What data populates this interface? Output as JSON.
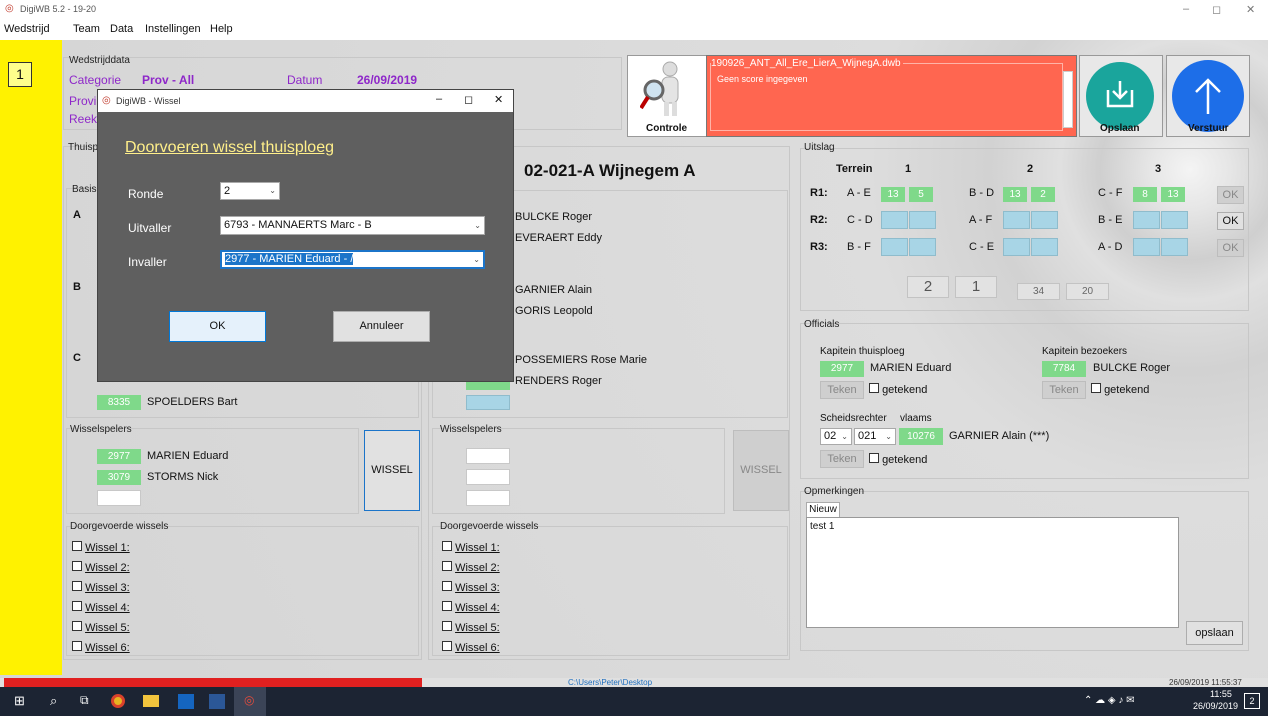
{
  "window": {
    "title": "DigiWB 5.2 - 19-20",
    "minimize": "–",
    "maximize": "◻",
    "close": "✕"
  },
  "menu": [
    "Wedstrijd",
    "Team",
    "Data",
    "Instellingen",
    "Help"
  ],
  "left_number": "1",
  "match": {
    "section_title": "Wedstrijddata",
    "categorie_label": "Categorie",
    "categorie_value": "Prov - All",
    "datum_label": "Datum",
    "datum_value": "26/09/2019",
    "prov_label_partial": "Provi",
    "reek_label_partial": "Reek"
  },
  "controle_label": "Controle",
  "file_panel": {
    "filename": "190926_ANT_All_Ere_LierA_WijnegA.dwb",
    "message": "Geen score ingegeven"
  },
  "opslaan_label": "Opslaan",
  "verstuur_label": "Verstuur",
  "home": {
    "section_partial": "Thuisp",
    "basis_partial": "Basis",
    "groups": [
      "A",
      "B",
      "C"
    ],
    "visible_player": {
      "num": "8335",
      "name": "SPOELDERS Bart"
    },
    "wissel_title": "Wisselspelers",
    "subs": [
      {
        "num": "2977",
        "name": "MARIEN Eduard"
      },
      {
        "num": "3079",
        "name": "STORMS Nick"
      }
    ],
    "wissel_btn": "WISSEL",
    "done_title": "Doorgevoerde wissels",
    "done": [
      "Wissel 1:",
      "Wissel 2:",
      "Wissel 3:",
      "Wissel 4:",
      "Wissel 5:",
      "Wissel 6:"
    ]
  },
  "away": {
    "team": "02-021-A Wijnegem A",
    "players": [
      "BULCKE Roger",
      "EVERAERT Eddy",
      "GARNIER Alain",
      "GORIS Leopold",
      "POSSEMIERS Rose Marie",
      "RENDERS Roger"
    ],
    "wissel_title": "Wisselspelers",
    "wissel_btn": "WISSEL",
    "done_title": "Doorgevoerde wissels",
    "done": [
      "Wissel 1:",
      "Wissel 2:",
      "Wissel 3:",
      "Wissel 4:",
      "Wissel 5:",
      "Wissel 6:"
    ]
  },
  "uitslag": {
    "title": "Uitslag",
    "terrein": "Terrein",
    "cols": [
      "1",
      "2",
      "3"
    ],
    "rounds": [
      {
        "label": "R1:",
        "m1": "A - E",
        "s1a": "13",
        "s1b": "5",
        "m2": "B - D",
        "s2a": "13",
        "s2b": "2",
        "m3": "C - F",
        "s3a": "8",
        "s3b": "13",
        "ok": "OK"
      },
      {
        "label": "R2:",
        "m1": "C - D",
        "m2": "A - F",
        "m3": "B - E",
        "ok": "OK"
      },
      {
        "label": "R3:",
        "m1": "B - F",
        "m2": "C - E",
        "m3": "A - D",
        "ok": "OK"
      }
    ],
    "totals": [
      "2",
      "1",
      "34",
      "20"
    ]
  },
  "officials": {
    "title": "Officials",
    "kap_thuis": "Kapitein thuisploeg",
    "kap_thuis_num": "2977",
    "kap_thuis_name": "MARIEN Eduard",
    "kap_bez": "Kapitein bezoekers",
    "kap_bez_num": "7784",
    "kap_bez_name": "BULCKE Roger",
    "teken": "Teken",
    "getekend": "getekend",
    "scheids": "Scheidsrechter",
    "vlaams": "vlaams",
    "sel1": "02",
    "sel2": "021",
    "ref_num": "10276",
    "ref_name": "GARNIER Alain (***)"
  },
  "opmerkingen": {
    "title": "Opmerkingen",
    "tab": "Nieuw",
    "text": "test 1",
    "save": "opslaan"
  },
  "dialog": {
    "title": "DigiWB - Wissel",
    "heading": "Doorvoeren wissel thuisploeg",
    "ronde_label": "Ronde",
    "ronde_value": "2",
    "uitvaller_label": "Uitvaller",
    "uitvaller_value": "6793 - MANNAERTS Marc - B",
    "invaller_label": "Invaller",
    "invaller_value": "2977 - MARIEN Eduard - /",
    "ok": "OK",
    "cancel": "Annuleer"
  },
  "status": {
    "path": "C:\\Users\\Peter\\Desktop",
    "datetime": "26/09/2019 11:55:37"
  },
  "taskbar": {
    "time": "11:55",
    "date": "26/09/2019",
    "notif": "2"
  }
}
